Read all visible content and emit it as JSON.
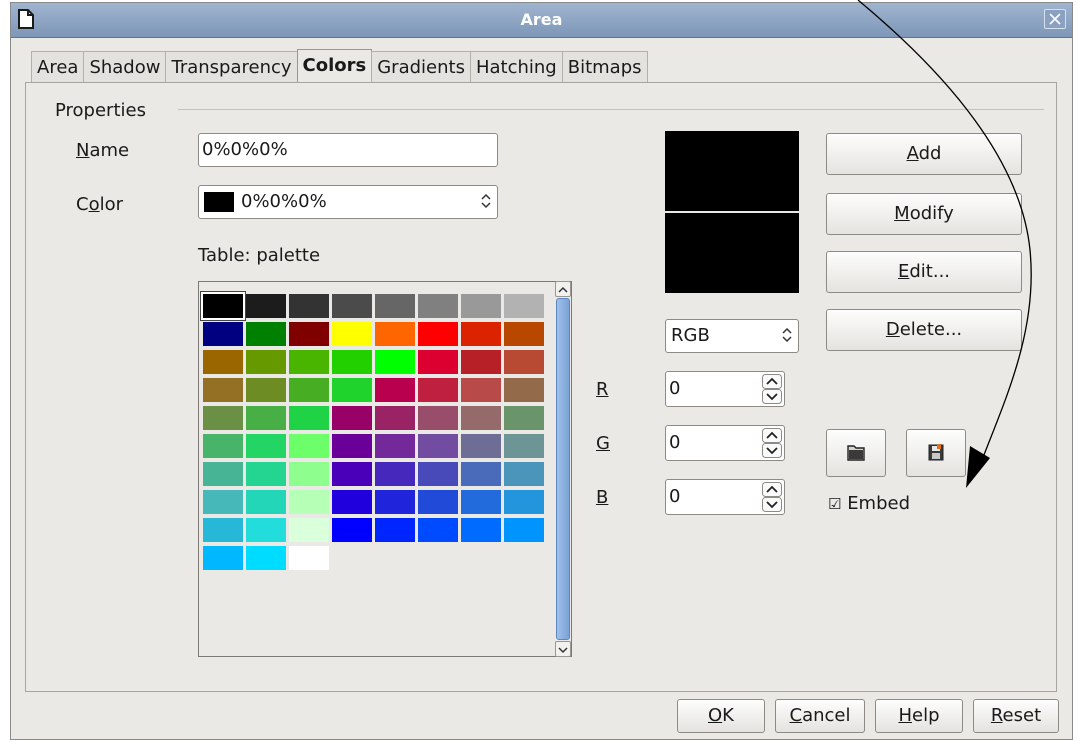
{
  "window": {
    "title": "Area",
    "tabs": [
      {
        "label": "Area",
        "active": false
      },
      {
        "label": "Shadow",
        "active": false
      },
      {
        "label": "Transparency",
        "active": false
      },
      {
        "label": "Colors",
        "active": true
      },
      {
        "label": "Gradients",
        "active": false
      },
      {
        "label": "Hatching",
        "active": false
      },
      {
        "label": "Bitmaps",
        "active": false
      }
    ]
  },
  "properties": {
    "group_label": "Properties",
    "name_label": "Name",
    "name_value": "0%0%0%",
    "color_label": "Color",
    "color_value": "0%0%0%",
    "table_label": "Table: palette"
  },
  "palette": {
    "selected_index": 0,
    "colors": [
      "#000000",
      "#1c1c1c",
      "#333333",
      "#4b4b4b",
      "#666666",
      "#808080",
      "#999999",
      "#b2b2b2",
      "#000080",
      "#008000",
      "#800000",
      "#ffff00",
      "#ff6600",
      "#ff0000",
      "#dc2300",
      "#b84700",
      "#996600",
      "#669900",
      "#4ab500",
      "#22d000",
      "#00ff00",
      "#dc0030",
      "#b82028",
      "#b84a33",
      "#937024",
      "#6d8c23",
      "#47ad23",
      "#20d22c",
      "#b8004f",
      "#bf2040",
      "#b84a4a",
      "#946b4a",
      "#6b8f45",
      "#47af45",
      "#20d245",
      "#970067",
      "#9a2366",
      "#984d6a",
      "#946a6a",
      "#6a946a",
      "#48b46a",
      "#23d565",
      "#6dff6a",
      "#6b0099",
      "#74299a",
      "#714ca0",
      "#6d6d95",
      "#6d9595",
      "#47b495",
      "#23d591",
      "#8eff8f",
      "#4a00b8",
      "#4628bc",
      "#484ab9",
      "#4a6bb9",
      "#4a95b9",
      "#46b8b9",
      "#23d6b8",
      "#b5ffb7",
      "#2000dc",
      "#2025dc",
      "#224ad8",
      "#226bdc",
      "#2295dc",
      "#26b8d6",
      "#23dcdc",
      "#d9ffdb",
      "#0000ff",
      "#0025ff",
      "#004bff",
      "#006cff",
      "#0094ff",
      "#00b8ff",
      "#00dcff",
      "#ffffff"
    ]
  },
  "color_model": {
    "value": "RGB",
    "r_label": "R",
    "g_label": "G",
    "b_label": "B",
    "r": "0",
    "g": "0",
    "b": "0"
  },
  "actions": {
    "add": "Add",
    "modify": "Modify",
    "edit": "Edit...",
    "delete": "Delete...",
    "embed_label": "Embed",
    "embed_checked": true
  },
  "footer": {
    "ok": "OK",
    "cancel": "Cancel",
    "help": "Help",
    "reset": "Reset"
  },
  "colors": {
    "titlebar": "#8ba2c2",
    "dialog_bg": "#ebe9e6",
    "preview": "#000000"
  }
}
